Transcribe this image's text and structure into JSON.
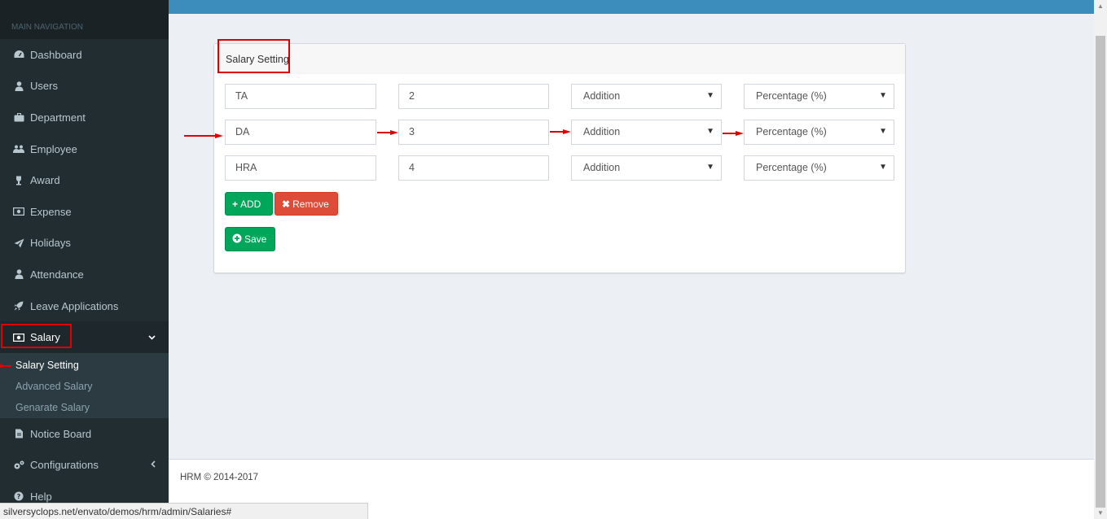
{
  "sidebar": {
    "header": "MAIN NAVIGATION",
    "items": [
      {
        "label": "Dashboard",
        "icon": "dashboard-icon"
      },
      {
        "label": "Users",
        "icon": "user-icon"
      },
      {
        "label": "Department",
        "icon": "briefcase-icon"
      },
      {
        "label": "Employee",
        "icon": "users-icon"
      },
      {
        "label": "Award",
        "icon": "trophy-icon"
      },
      {
        "label": "Expense",
        "icon": "money-icon"
      },
      {
        "label": "Holidays",
        "icon": "paper-plane-icon"
      },
      {
        "label": "Attendance",
        "icon": "user-icon"
      },
      {
        "label": "Leave Applications",
        "icon": "rocket-icon"
      },
      {
        "label": "Salary",
        "icon": "money-icon"
      },
      {
        "label": "Notice Board",
        "icon": "file-icon"
      },
      {
        "label": "Configurations",
        "icon": "gears-icon"
      },
      {
        "label": "Help",
        "icon": "question-icon"
      }
    ],
    "salary_submenu": [
      "Salary Setting",
      "Advanced Salary",
      "Genarate Salary"
    ]
  },
  "panel": {
    "title": "Salary Setting",
    "rows": [
      {
        "name": "TA",
        "value": "2",
        "type": "Addition",
        "unit": "Percentage (%)"
      },
      {
        "name": "DA",
        "value": "3",
        "type": "Addition",
        "unit": "Percentage (%)"
      },
      {
        "name": "HRA",
        "value": "4",
        "type": "Addition",
        "unit": "Percentage (%)"
      }
    ],
    "add_label": "ADD",
    "remove_label": "Remove",
    "save_label": "Save"
  },
  "footer": {
    "text": "HRM © 2014-2017"
  },
  "status_url": "silversyclops.net/envato/demos/hrm/admin/Salaries#",
  "colors": {
    "topbar": "#3c8dbc",
    "sidebar": "#222d32",
    "green": "#00a65a",
    "red": "#dd4b39",
    "annotation": "#e00000"
  }
}
